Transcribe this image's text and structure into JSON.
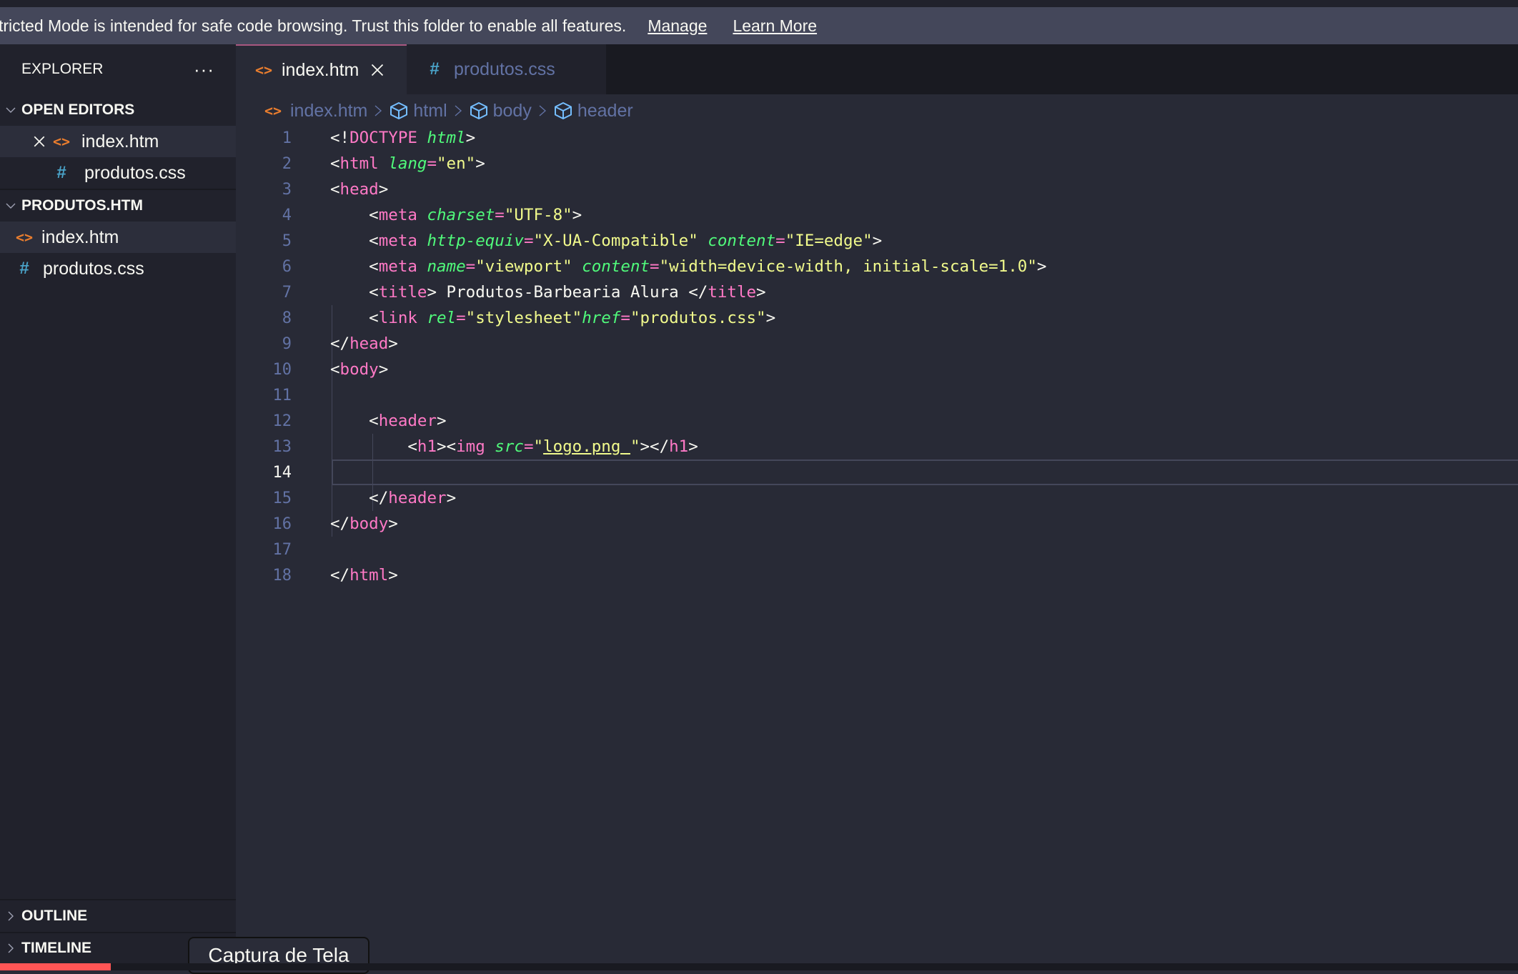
{
  "banner": {
    "message": "tricted Mode is intended for safe code browsing. Trust this folder to enable all features.",
    "links": [
      "Manage",
      "Learn More"
    ]
  },
  "sidebar": {
    "title": "EXPLORER",
    "more_icon": "ellipsis-icon",
    "open_editors": {
      "title": "OPEN EDITORS",
      "items": [
        {
          "name": "index.htm",
          "icon": "html-file-icon",
          "active": true
        },
        {
          "name": "produtos.css",
          "icon": "css-file-icon",
          "active": false
        }
      ]
    },
    "folder": {
      "title": "PRODUTOS.HTM",
      "items": [
        {
          "name": "index.htm",
          "icon": "html-file-icon",
          "selected": true
        },
        {
          "name": "produtos.css",
          "icon": "css-file-icon",
          "selected": false
        }
      ]
    },
    "outline": "OUTLINE",
    "timeline": "TIMELINE"
  },
  "tabs": [
    {
      "label": "index.htm",
      "icon": "html-file-icon",
      "active": true
    },
    {
      "label": "produtos.css",
      "icon": "css-file-icon",
      "active": false
    }
  ],
  "breadcrumb": [
    "index.htm",
    "html",
    "body",
    "header"
  ],
  "editor": {
    "current_line": 14,
    "lines": [
      {
        "n": "1"
      },
      {
        "n": "2"
      },
      {
        "n": "3"
      },
      {
        "n": "4"
      },
      {
        "n": "5"
      },
      {
        "n": "6"
      },
      {
        "n": "7"
      },
      {
        "n": "8"
      },
      {
        "n": "9"
      },
      {
        "n": "10"
      },
      {
        "n": "11"
      },
      {
        "n": "12"
      },
      {
        "n": "13"
      },
      {
        "n": "14"
      },
      {
        "n": "15"
      },
      {
        "n": "16"
      },
      {
        "n": "17"
      },
      {
        "n": "18"
      }
    ],
    "code": [
      [
        [
          "p",
          "<!"
        ],
        [
          "t",
          "DOCTYPE"
        ],
        [
          "p",
          " "
        ],
        [
          "a",
          "html"
        ],
        [
          "p",
          ">"
        ]
      ],
      [
        [
          "p",
          "<"
        ],
        [
          "t",
          "html"
        ],
        [
          "p",
          " "
        ],
        [
          "a",
          "lang"
        ],
        [
          "t",
          "="
        ],
        [
          "s",
          "\"en\""
        ],
        [
          "p",
          ">"
        ]
      ],
      [
        [
          "p",
          "<"
        ],
        [
          "t",
          "head"
        ],
        [
          "p",
          ">"
        ]
      ],
      [
        [
          "p",
          "    <"
        ],
        [
          "t",
          "meta"
        ],
        [
          "p",
          " "
        ],
        [
          "a",
          "charset"
        ],
        [
          "t",
          "="
        ],
        [
          "s",
          "\"UTF-8\""
        ],
        [
          "p",
          ">"
        ]
      ],
      [
        [
          "p",
          "    <"
        ],
        [
          "t",
          "meta"
        ],
        [
          "p",
          " "
        ],
        [
          "a",
          "http-equiv"
        ],
        [
          "t",
          "="
        ],
        [
          "s",
          "\"X-UA-Compatible\""
        ],
        [
          "p",
          " "
        ],
        [
          "a",
          "content"
        ],
        [
          "t",
          "="
        ],
        [
          "s",
          "\"IE=edge\""
        ],
        [
          "p",
          ">"
        ]
      ],
      [
        [
          "p",
          "    <"
        ],
        [
          "t",
          "meta"
        ],
        [
          "p",
          " "
        ],
        [
          "a",
          "name"
        ],
        [
          "t",
          "="
        ],
        [
          "s",
          "\"viewport\""
        ],
        [
          "p",
          " "
        ],
        [
          "a",
          "content"
        ],
        [
          "t",
          "="
        ],
        [
          "s",
          "\"width=device-width, initial-scale=1.0\""
        ],
        [
          "p",
          ">"
        ]
      ],
      [
        [
          "p",
          "    <"
        ],
        [
          "t",
          "title"
        ],
        [
          "p",
          "> Produtos-Barbearia Alura </"
        ],
        [
          "t",
          "title"
        ],
        [
          "p",
          ">"
        ]
      ],
      [
        [
          "p",
          "    <"
        ],
        [
          "t",
          "link"
        ],
        [
          "p",
          " "
        ],
        [
          "a",
          "rel"
        ],
        [
          "t",
          "="
        ],
        [
          "s",
          "\"stylesheet\""
        ],
        [
          "a",
          "href"
        ],
        [
          "t",
          "="
        ],
        [
          "s",
          "\"produtos.css\""
        ],
        [
          "p",
          ">"
        ]
      ],
      [
        [
          "p",
          "</"
        ],
        [
          "t",
          "head"
        ],
        [
          "p",
          ">"
        ]
      ],
      [
        [
          "p",
          "<"
        ],
        [
          "t",
          "body"
        ],
        [
          "p",
          ">"
        ]
      ],
      [],
      [
        [
          "p",
          "    <"
        ],
        [
          "t",
          "header"
        ],
        [
          "p",
          ">"
        ]
      ],
      [
        [
          "p",
          "        <"
        ],
        [
          "t",
          "h1"
        ],
        [
          "p",
          "><"
        ],
        [
          "t",
          "img"
        ],
        [
          "p",
          " "
        ],
        [
          "a",
          "src"
        ],
        [
          "t",
          "="
        ],
        [
          "s",
          "\""
        ],
        [
          "su",
          "logo.png "
        ],
        [
          "s",
          "\""
        ],
        [
          "p",
          "></"
        ],
        [
          "t",
          "h1"
        ],
        [
          "p",
          ">"
        ]
      ],
      [],
      [
        [
          "p",
          "    </"
        ],
        [
          "t",
          "header"
        ],
        [
          "p",
          ">"
        ]
      ],
      [
        [
          "p",
          "</"
        ],
        [
          "t",
          "body"
        ],
        [
          "p",
          ">"
        ]
      ],
      [],
      [
        [
          "p",
          "</"
        ],
        [
          "t",
          "html"
        ],
        [
          "p",
          ">"
        ]
      ]
    ]
  },
  "tooltip": "Captura de Tela",
  "colors": {
    "background": "#282a36",
    "sidebar": "#21222c",
    "banner": "#44475a",
    "tag": "#ff79c6",
    "attribute": "#50fa7b",
    "string": "#f1fa8c",
    "html_icon": "#e97d2e",
    "css_icon": "#4aa3c8",
    "status_accent": "#ff5555"
  }
}
